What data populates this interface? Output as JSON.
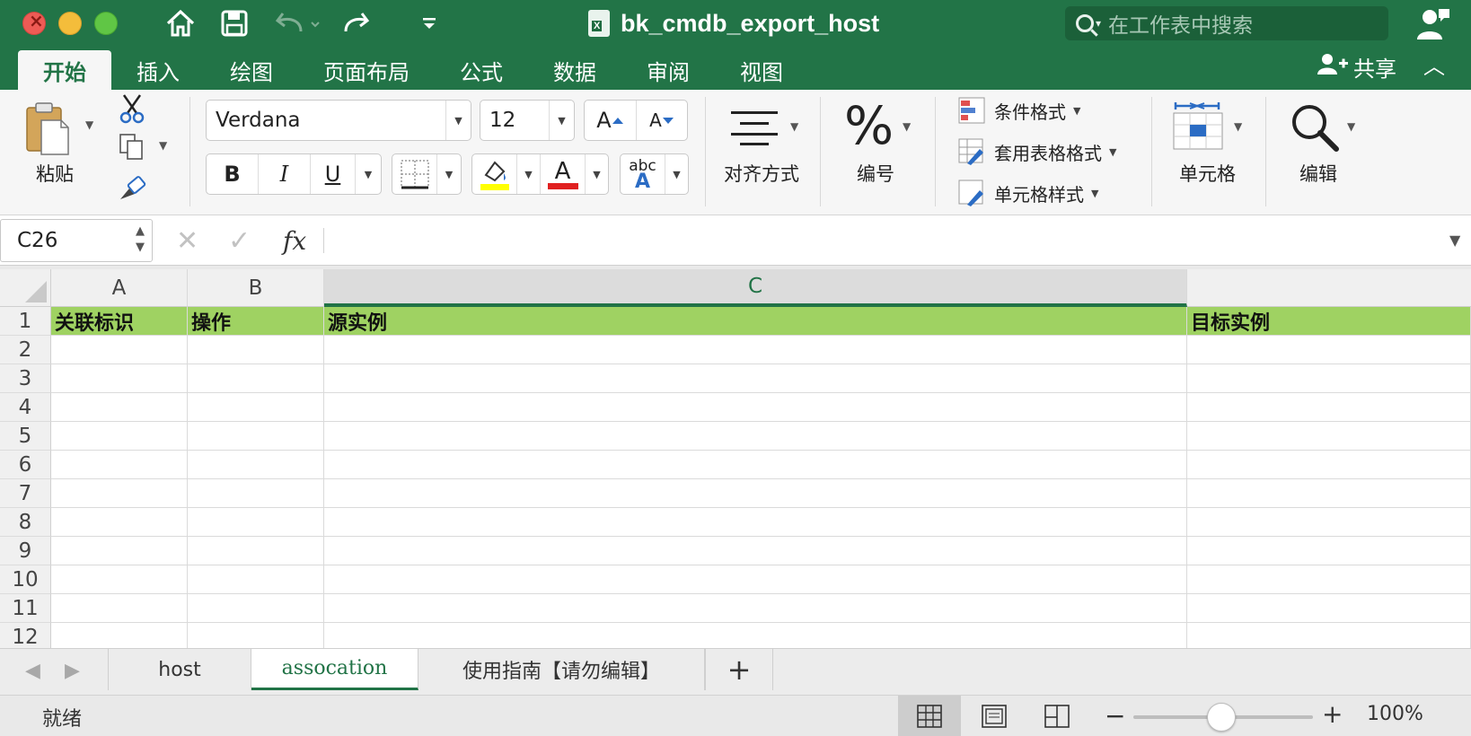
{
  "window": {
    "title": "bk_cmdb_export_host",
    "search_placeholder": "在工作表中搜索"
  },
  "ribbon_tabs": [
    "开始",
    "插入",
    "绘图",
    "页面布局",
    "公式",
    "数据",
    "审阅",
    "视图"
  ],
  "share_label": "共享",
  "ribbon": {
    "paste_label": "粘贴",
    "font_name": "Verdana",
    "font_size": "12",
    "bold": "B",
    "italic": "I",
    "underline": "U",
    "increase_font": "A",
    "decrease_font": "A",
    "font_color_letter": "A",
    "spell_abc": "abc",
    "spell_a": "A",
    "align_label": "对齐方式",
    "number_symbol": "%",
    "number_label": "编号",
    "conditional_format": "条件格式",
    "format_as_table": "套用表格格式",
    "cell_styles": "单元格样式",
    "cells_label": "单元格",
    "editing_label": "编辑",
    "highlight_color": "#ffff00",
    "font_color": "#e02020"
  },
  "formula_bar": {
    "name_box": "C26",
    "fx": "fx",
    "formula": ""
  },
  "grid": {
    "columns": [
      "A",
      "B",
      "C",
      ""
    ],
    "selected_column": "C",
    "row_numbers": [
      "1",
      "2",
      "3",
      "4",
      "5",
      "6",
      "7",
      "8",
      "9",
      "10",
      "11",
      "12"
    ],
    "header_row": [
      "关联标识",
      "操作",
      "源实例",
      "目标实例"
    ],
    "header_fill": "#9fd262"
  },
  "sheets": {
    "tabs": [
      "host",
      "assocation",
      "使用指南【请勿编辑】"
    ],
    "active": "assocation",
    "add": "+"
  },
  "status": {
    "text": "就绪",
    "zoom": "100%",
    "zoom_minus": "−",
    "zoom_plus": "+"
  }
}
